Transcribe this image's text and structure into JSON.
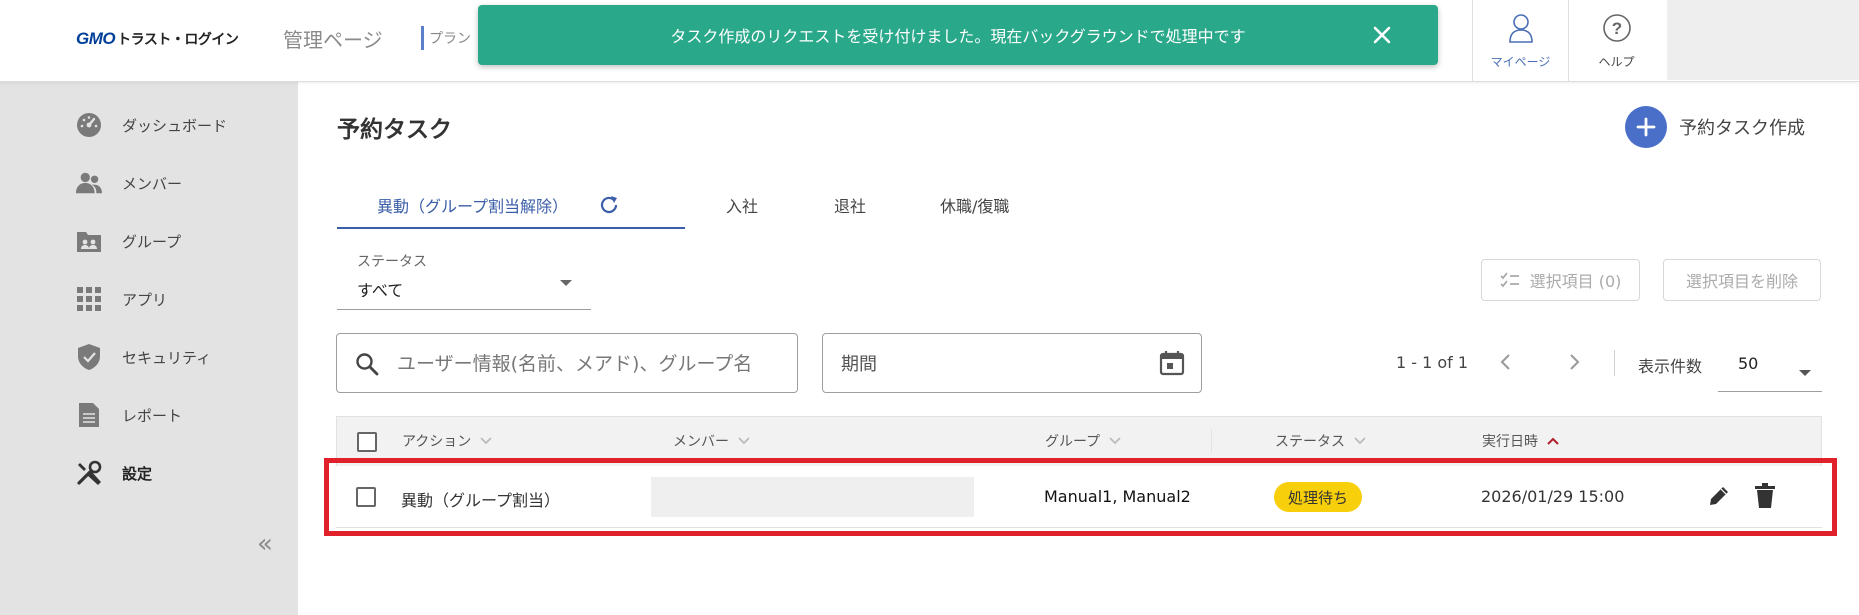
{
  "header": {
    "logo_gmo": "GMO",
    "logo_brand": "トラスト・ログイン",
    "admin_title": "管理ページ",
    "plan_text": "プラン",
    "mypage_label": "マイページ",
    "help_label": "ヘルプ"
  },
  "toast": {
    "message": "タスク作成のリクエストを受け付けました。現在バックグラウンドで処理中です"
  },
  "sidebar": {
    "items": [
      {
        "label": "ダッシュボード",
        "icon": "dashboard-icon"
      },
      {
        "label": "メンバー",
        "icon": "members-icon"
      },
      {
        "label": "グループ",
        "icon": "group-icon"
      },
      {
        "label": "アプリ",
        "icon": "apps-grid-icon"
      },
      {
        "label": "セキュリティ",
        "icon": "shield-icon"
      },
      {
        "label": "レポート",
        "icon": "report-icon"
      },
      {
        "label": "設定",
        "icon": "tools-icon"
      }
    ],
    "collapse_glyph": "«"
  },
  "main": {
    "title": "予約タスク",
    "create_label": "予約タスク作成",
    "tabs": [
      {
        "label": "異動（グループ割当解除）"
      },
      {
        "label": "入社"
      },
      {
        "label": "退社"
      },
      {
        "label": "休職/復職"
      }
    ],
    "status_filter": {
      "label": "ステータス",
      "value": "すべて"
    },
    "select_items_label": "選択項目 (0)",
    "delete_selected_label": "選択項目を削除",
    "search_placeholder": "ユーザー情報(名前、メアド)、グループ名",
    "period_placeholder": "期間",
    "pager_text": "1 - 1 of 1",
    "per_page_label": "表示件数",
    "per_page_value": "50"
  },
  "table": {
    "headers": {
      "action": "アクション",
      "member": "メンバー",
      "group": "グループ",
      "status": "ステータス",
      "executed_at": "実行日時"
    },
    "rows": [
      {
        "action": "異動（グループ割当）",
        "member": "",
        "group": "Manual1, Manual2",
        "status": "処理待ち",
        "executed_at": "2026/01/29 15:00"
      }
    ]
  },
  "colors": {
    "toast_bg": "#2aa88a",
    "accent_blue": "#3b5ea8",
    "status_badge": "#f7cf0a",
    "highlight_red": "#e0202a"
  }
}
